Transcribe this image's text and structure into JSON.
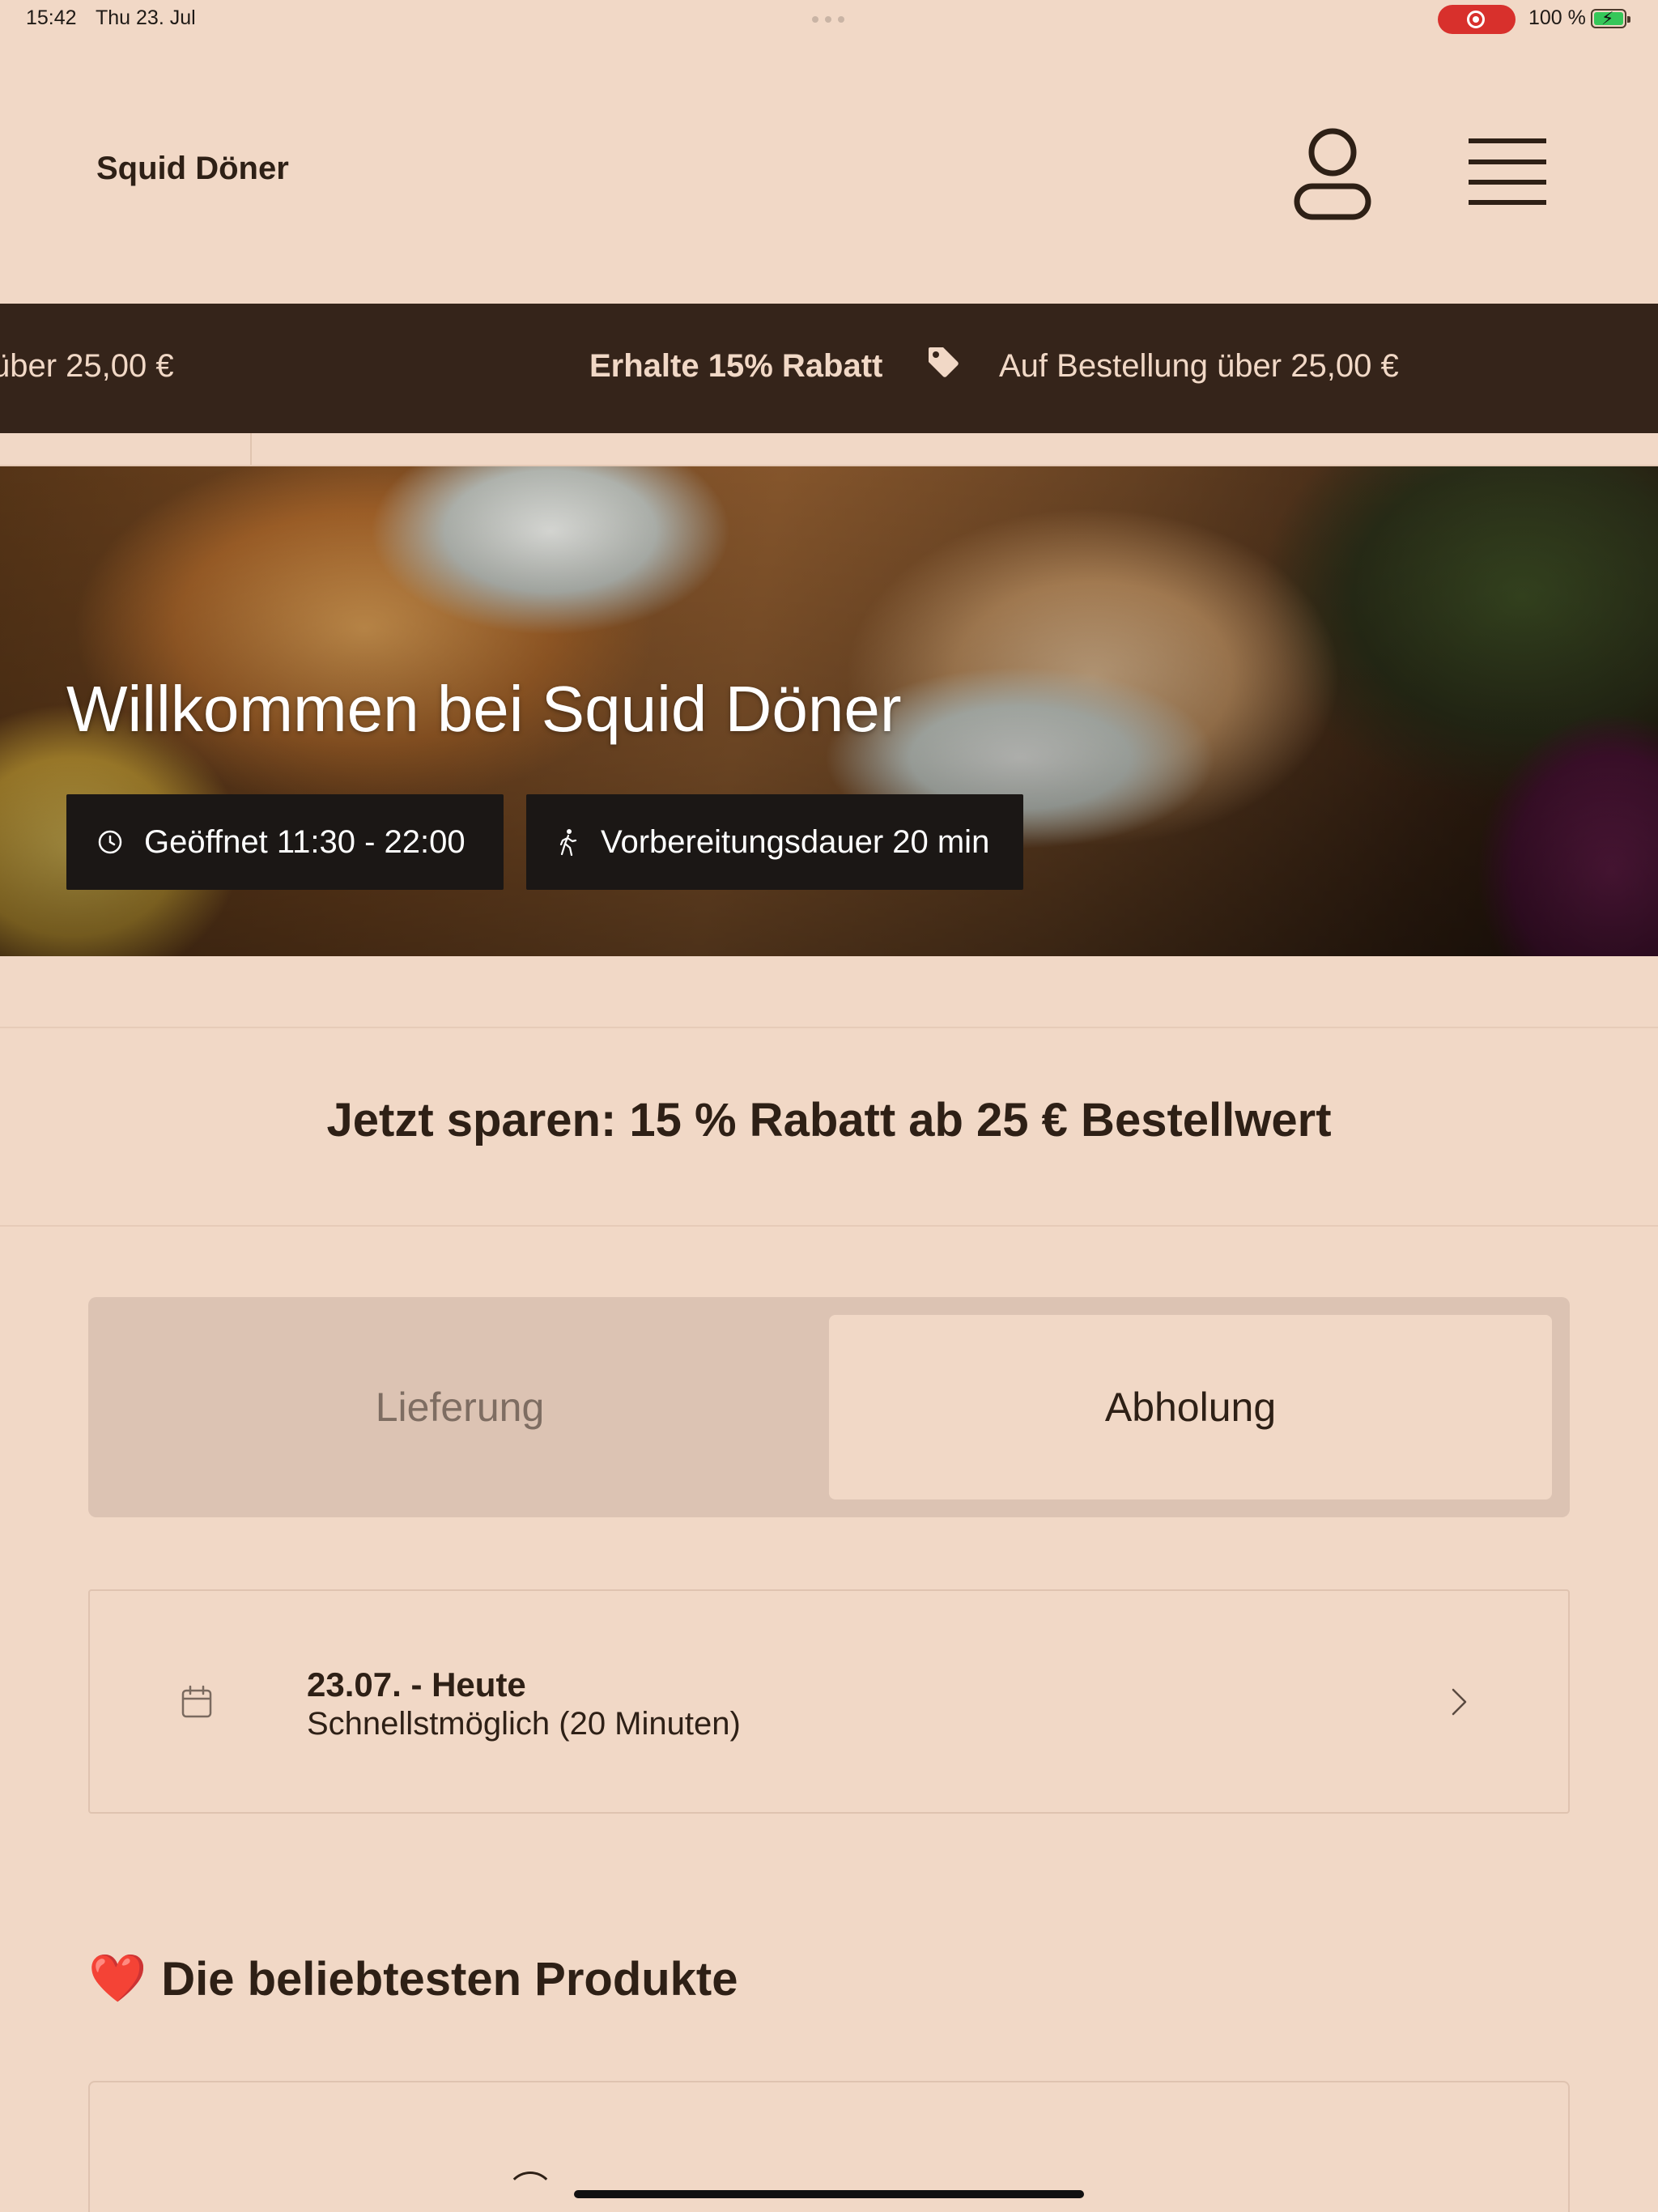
{
  "status_bar": {
    "time": "15:42",
    "date": "Thu 23. Jul",
    "battery_percent": "100 %"
  },
  "header": {
    "brand": "Squid Döner",
    "icons": {
      "account": "user-icon",
      "menu": "hamburger-menu-icon"
    }
  },
  "promo_banner": {
    "left_fragment": "über 25,00 €",
    "bold_text": "Erhalte 15% Rabatt",
    "tag_icon": "tag-icon",
    "right_text": "Auf Bestellung über 25,00 €"
  },
  "hero": {
    "title": "Willkommen bei Squid Döner",
    "opening_hours": "Geöffnet 11:30 - 22:00",
    "prep_time": "Vorbereitungsdauer 20 min",
    "icons": {
      "hours": "clock-icon",
      "prep": "walking-icon"
    }
  },
  "promo_heading": "Jetzt sparen: 15 % Rabatt ab 25 € Bestellwert",
  "order_mode": {
    "options": [
      "Lieferung",
      "Abholung"
    ],
    "selected": "Abholung"
  },
  "pickup_time": {
    "title": "23.07. - Heute",
    "subtitle": "Schnellstmöglich (20 Minuten)",
    "icon": "calendar-icon"
  },
  "popular": {
    "emoji": "❤️",
    "heading": "Die beliebtesten Produkte"
  },
  "colors": {
    "background": "#f1d8c6",
    "dark_brown": "#35241a",
    "text": "#2e2016",
    "chip": "#1b1715",
    "segment_track": "#dcc3b3"
  }
}
